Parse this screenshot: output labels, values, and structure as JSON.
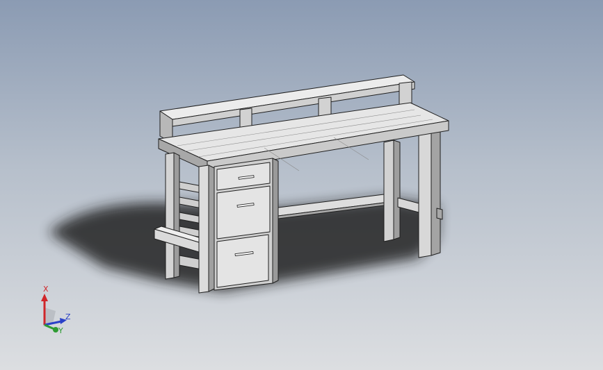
{
  "viewport": {
    "background_top": "#8b9bb3",
    "background_bottom": "#dcdee1"
  },
  "model": {
    "subject": "workbench-with-drawers",
    "edge_color": "#1e1e1e",
    "face_light": "#e6e6e6",
    "face_mid": "#c8c8c8",
    "face_dark": "#9e9e9e",
    "shadow_color": "#1c1c1c"
  },
  "triad": {
    "x_label": "X",
    "y_label": "Y",
    "z_label": "Z",
    "x_color": "#d0262a",
    "y_color": "#2e9b33",
    "z_color": "#2a41c8"
  }
}
